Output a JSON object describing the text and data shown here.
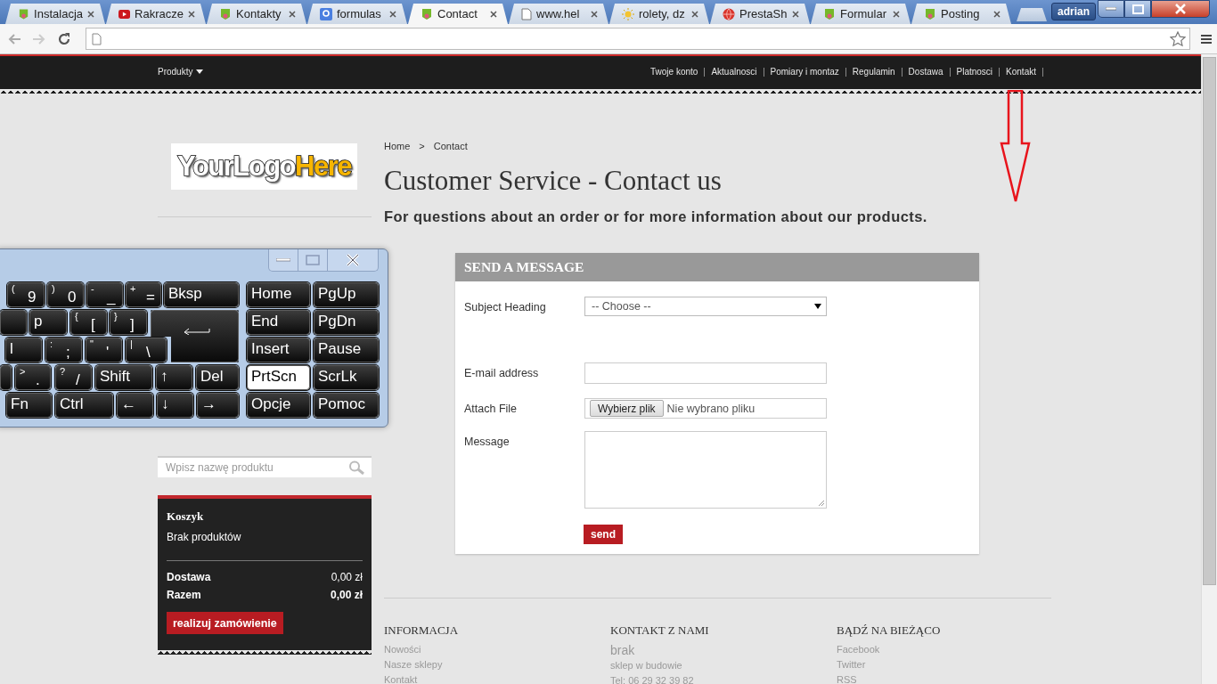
{
  "browser": {
    "tabs": [
      {
        "title": "Instalacja",
        "kind": "leaf",
        "selected": false
      },
      {
        "title": "Rakracze",
        "kind": "video",
        "selected": false
      },
      {
        "title": "Kontakty",
        "kind": "leaf",
        "selected": false
      },
      {
        "title": "formulas",
        "kind": "google",
        "selected": false
      },
      {
        "title": "Contact",
        "kind": "leaf",
        "selected": true
      },
      {
        "title": "www.hel",
        "kind": "doc",
        "selected": false
      },
      {
        "title": "rolety, dz",
        "kind": "sun",
        "selected": false
      },
      {
        "title": "PrestaSh",
        "kind": "globe",
        "selected": false
      },
      {
        "title": "Formular",
        "kind": "leaf",
        "selected": false
      },
      {
        "title": "Posting",
        "kind": "leaf",
        "selected": false
      }
    ],
    "user": "adrian"
  },
  "nav": {
    "menu": "Produkty",
    "links": [
      "Twoje konto",
      "Aktualnosci",
      "Pomiary i montaz",
      "Regulamin",
      "Dostawa",
      "Platnosci",
      "Kontakt"
    ]
  },
  "logo": [
    "YourLogo",
    "Here"
  ],
  "search": {
    "placeholder": "Wpisz nazwę produktu"
  },
  "cart": {
    "title": "Koszyk",
    "empty": "Brak produktów",
    "rows": [
      {
        "label": "Dostawa",
        "value": "0,00 zł",
        "total": false
      },
      {
        "label": "Razem",
        "value": "0,00 zł",
        "total": true
      }
    ],
    "button": "realizuj zamówienie"
  },
  "breadcrumb": [
    "Home",
    ">",
    "Contact"
  ],
  "heading": "Customer Service - Contact us",
  "subheading": "For questions about an order or for more information about our products.",
  "form": {
    "title": "SEND A MESSAGE",
    "fields": [
      {
        "kind": "select",
        "label": "Subject Heading",
        "value": "-- Choose --"
      },
      {
        "kind": "text",
        "label": "E-mail address"
      },
      {
        "kind": "file",
        "label": "Attach File",
        "button": "Wybierz plik",
        "value": "Nie wybrano pliku"
      },
      {
        "kind": "textarea",
        "label": "Message"
      }
    ],
    "submit": "send"
  },
  "footer": [
    {
      "title": "INFORMACJA",
      "items": [
        "Nowości",
        "Nasze sklepy",
        "Kontakt"
      ]
    },
    {
      "title": "KONTAKT Z NAMI",
      "name": "brak",
      "items": [
        "sklep w budowie",
        "Tel: 06 29 32 39 82"
      ]
    },
    {
      "title": "BĄDŹ NA BIEŻĄCO",
      "items": [
        "Facebook",
        "Twitter",
        "RSS"
      ]
    }
  ],
  "keyboard": {
    "keys": [
      {
        "kind": "char",
        "top": "(",
        "main": "9",
        "selected": false
      },
      {
        "kind": "char",
        "top": ")",
        "main": "0",
        "selected": false
      },
      {
        "kind": "char",
        "top": "-",
        "main": "_",
        "selected": false
      },
      {
        "kind": "char",
        "top": "+",
        "main": "=",
        "selected": false
      },
      {
        "kind": "label",
        "main": "Bksp",
        "selected": false
      },
      {
        "kind": "label",
        "main": "Home",
        "selected": false
      },
      {
        "kind": "label",
        "main": "PgUp",
        "selected": false
      },
      {
        "kind": "label",
        "main": "p",
        "selected": false
      },
      {
        "kind": "char",
        "top": "{",
        "main": "[",
        "selected": false
      },
      {
        "kind": "char",
        "top": "}",
        "main": "]",
        "selected": false
      },
      {
        "kind": "enter",
        "selected": false
      },
      {
        "kind": "label",
        "main": "End",
        "selected": false
      },
      {
        "kind": "label",
        "main": "PgDn",
        "selected": false
      },
      {
        "kind": "label",
        "main": "l",
        "selected": false
      },
      {
        "kind": "char",
        "top": ":",
        "main": ";",
        "selected": false
      },
      {
        "kind": "char",
        "top": "\"",
        "main": "'",
        "selected": false
      },
      {
        "kind": "char",
        "top": "|",
        "main": "\\",
        "selected": false
      },
      {
        "kind": "label",
        "main": "Insert",
        "selected": false
      },
      {
        "kind": "label",
        "main": "Pause",
        "selected": false
      },
      {
        "kind": "char",
        "top": ">",
        "main": ".",
        "selected": false
      },
      {
        "kind": "char",
        "top": "?",
        "main": "/",
        "selected": false
      },
      {
        "kind": "label",
        "main": "Shift",
        "selected": false
      },
      {
        "kind": "label",
        "main": "↑",
        "selected": false
      },
      {
        "kind": "label",
        "main": "Del",
        "selected": false
      },
      {
        "kind": "label",
        "main": "PrtScn",
        "selected": true
      },
      {
        "kind": "label",
        "main": "ScrLk",
        "selected": false
      },
      {
        "kind": "label",
        "main": "Fn",
        "selected": false
      },
      {
        "kind": "label",
        "main": "Ctrl",
        "selected": false
      },
      {
        "kind": "label",
        "main": "←",
        "selected": false
      },
      {
        "kind": "label",
        "main": "↓",
        "selected": false
      },
      {
        "kind": "label",
        "main": "→",
        "selected": false
      },
      {
        "kind": "label",
        "main": "Opcje",
        "selected": false
      },
      {
        "kind": "label",
        "main": "Pomoc",
        "selected": false
      }
    ]
  }
}
